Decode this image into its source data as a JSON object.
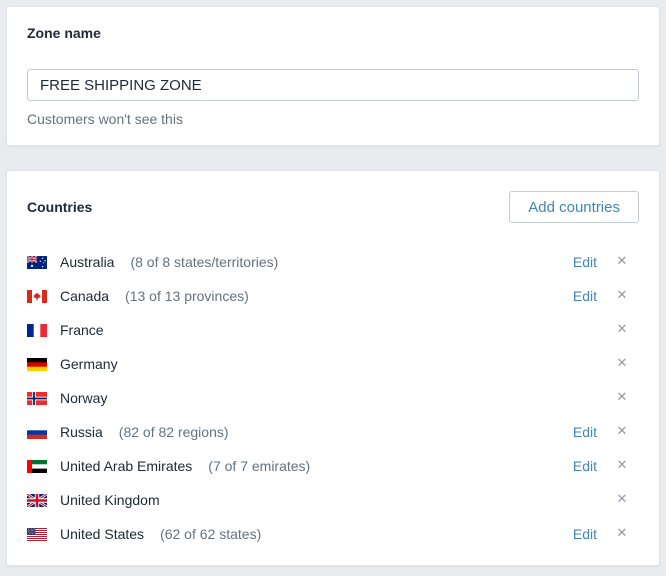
{
  "zone_card": {
    "label": "Zone name",
    "input_value": "FREE SHIPPING ZONE",
    "helper_text": "Customers won't see this"
  },
  "countries_card": {
    "title": "Countries",
    "add_button_label": "Add countries",
    "edit_label": "Edit",
    "remove_icon": "✕",
    "rows": [
      {
        "name": "Australia",
        "subcount": "(8 of 8 states/territories)",
        "flag": "australia",
        "edit": true
      },
      {
        "name": "Canada",
        "subcount": "(13 of 13 provinces)",
        "flag": "canada",
        "edit": true
      },
      {
        "name": "France",
        "subcount": "",
        "flag": "france",
        "edit": false
      },
      {
        "name": "Germany",
        "subcount": "",
        "flag": "germany",
        "edit": false
      },
      {
        "name": "Norway",
        "subcount": "",
        "flag": "norway",
        "edit": false
      },
      {
        "name": "Russia",
        "subcount": "(82 of 82 regions)",
        "flag": "russia",
        "edit": true
      },
      {
        "name": "United Arab Emirates",
        "subcount": "(7 of 7 emirates)",
        "flag": "united-arab-emirates",
        "edit": true
      },
      {
        "name": "United Kingdom",
        "subcount": "",
        "flag": "united-kingdom",
        "edit": false
      },
      {
        "name": "United States",
        "subcount": "(62 of 62 states)",
        "flag": "united-states",
        "edit": true
      }
    ]
  },
  "colors": {
    "accent_link": "#4385b5",
    "page_background": "#e8ecef",
    "card_background": "#ffffff",
    "card_border": "#dfe3e8",
    "text_primary": "#212b36",
    "text_secondary": "#637381",
    "remove_icon_gray": "#919ba3"
  }
}
